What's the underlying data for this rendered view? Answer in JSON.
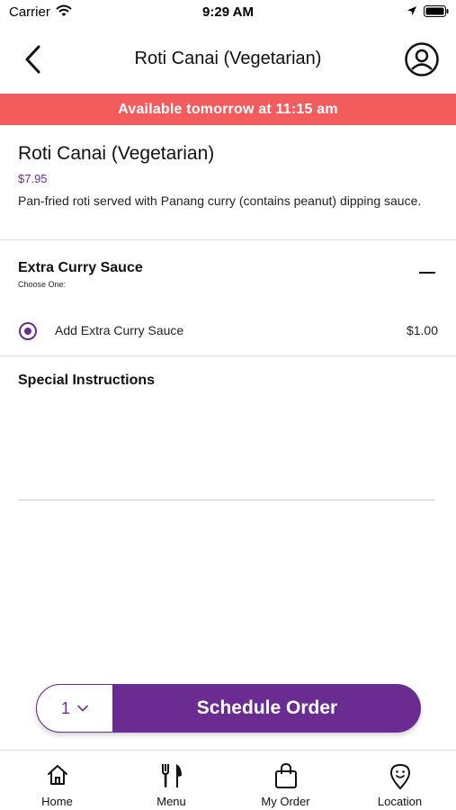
{
  "status_bar": {
    "carrier": "Carrier",
    "time": "9:29 AM"
  },
  "nav": {
    "title": "Roti Canai (Vegetarian)",
    "back_icon": "chevron-left-icon",
    "profile_icon": "user-circle-icon"
  },
  "banner": {
    "text": "Available tomorrow at 11:15 am",
    "color": "#f25c5c"
  },
  "item": {
    "name": "Roti Canai (Vegetarian)",
    "price": "$7.95",
    "description": "Pan-fried roti served with Panang curry (contains peanut) dipping sauce."
  },
  "option_group": {
    "title": "Extra Curry Sauce",
    "subtitle": "Choose One:",
    "options": [
      {
        "label": "Add Extra Curry Sauce",
        "price": "$1.00",
        "selected": true
      }
    ]
  },
  "instructions": {
    "title": "Special Instructions",
    "value": ""
  },
  "order": {
    "quantity": "1",
    "button_label": "Schedule Order",
    "accent": "#6a2c91"
  },
  "tabs": [
    {
      "label": "Home",
      "icon": "home-icon"
    },
    {
      "label": "Menu",
      "icon": "fork-knife-icon"
    },
    {
      "label": "My Order",
      "icon": "shopping-bag-icon"
    },
    {
      "label": "Location",
      "icon": "location-pin-icon"
    }
  ]
}
